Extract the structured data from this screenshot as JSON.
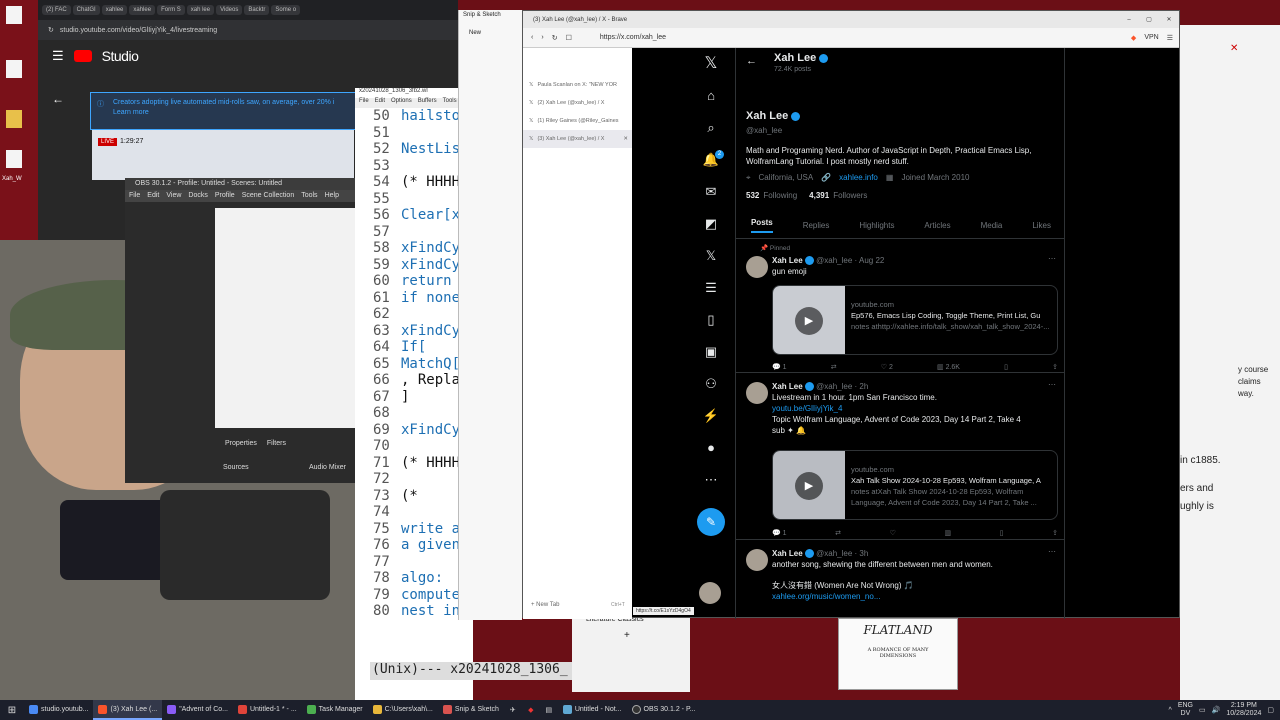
{
  "youtube": {
    "tabs": [
      "(2) FAC",
      "ChatGI",
      "xahlee",
      "xahlee",
      "Form S",
      "xah lee",
      "Videos",
      "Backtr",
      "Some o"
    ],
    "url": "studio.youtube.com/video/GlIiyjYik_4/livestreaming",
    "logo": "Studio",
    "banner_line1": "Creators adopting live automated mid-rolls saw, on average, over 20% i",
    "banner_line2": "Learn more",
    "live_badge": "LIVE",
    "live_time": "1:29:27"
  },
  "obs": {
    "title": "OBS 30.1.2 - Profile: Untitled - Scenes: Untitled",
    "menu": [
      "File",
      "Edit",
      "View",
      "Docks",
      "Profile",
      "Scene Collection",
      "Tools",
      "Help"
    ],
    "panels": [
      "Properties",
      "Filters"
    ],
    "sources": "Sources",
    "mixer": "Audio Mixer"
  },
  "emacs": {
    "title": "x20241028_1306_3fb2.wl",
    "menu": [
      "File",
      "Edit",
      "Options",
      "Buffers",
      "Tools"
    ],
    "lines": [
      {
        "n": "50",
        "t": "hailstor"
      },
      {
        "n": "51",
        "t": ""
      },
      {
        "n": "52",
        "t": "NestList"
      },
      {
        "n": "53",
        "t": ""
      },
      {
        "n": "54",
        "t": "(* HHHH-"
      },
      {
        "n": "55",
        "t": ""
      },
      {
        "n": "56",
        "t": "Clear[xF"
      },
      {
        "n": "57",
        "t": ""
      },
      {
        "n": "58",
        "t": "xFindCyc"
      },
      {
        "n": "59",
        "t": "xFindCyc"
      },
      {
        "n": "60",
        "t": "return a"
      },
      {
        "n": "61",
        "t": "if none,"
      },
      {
        "n": "62",
        "t": ""
      },
      {
        "n": "63",
        "t": "xFindCyc"
      },
      {
        "n": "64",
        "t": "If["
      },
      {
        "n": "65",
        "t": "MatchQ["
      },
      {
        "n": "66",
        "t": ", Replac"
      },
      {
        "n": "67",
        "t": "]"
      },
      {
        "n": "68",
        "t": ""
      },
      {
        "n": "69",
        "t": "xFindCyc"
      },
      {
        "n": "70",
        "t": ""
      },
      {
        "n": "71",
        "t": "(* HHHH-"
      },
      {
        "n": "72",
        "t": ""
      },
      {
        "n": "73",
        "t": "(*"
      },
      {
        "n": "74",
        "t": ""
      },
      {
        "n": "75",
        "t": "write a"
      },
      {
        "n": "76",
        "t": "a given"
      },
      {
        "n": "77",
        "t": ""
      },
      {
        "n": "78",
        "t": "algo:"
      },
      {
        "n": "79",
        "t": "compute the function s"
      },
      {
        "n": "80",
        "t": "nest in, for n times."
      }
    ],
    "modeline": "(Unix)--- x20241028_1306_"
  },
  "snip": {
    "title": "Snip & Sketch",
    "new": "New",
    "folder": "Literature Classics",
    "book_title": "FLATLAND",
    "book_sub": "A ROMANCE OF MANY DIMENSIONS"
  },
  "brave": {
    "title": "(3) Xah Lee (@xah_lee) / X - Brave",
    "url": "https://x.com/xah_lee",
    "vpn": "VPN",
    "tabs": [
      "Paula Scanlan on X: \"NEW YOR",
      "(2) Xah Lee (@xah_lee) / X",
      "(1) Riley Gaines (@Riley_Gaines",
      "(3) Xah Lee (@xah_lee) / X"
    ],
    "new_tab": "New Tab",
    "new_tab_shortcut": "Ctrl+T",
    "status_url": "https://t.co/E1sYzD4gO4"
  },
  "x": {
    "header_name": "Xah Lee",
    "header_posts": "72.4K posts",
    "name": "Xah Lee",
    "handle": "@xah_lee",
    "bio": "Math and Programing Nerd. Author of JavaScript in Depth, Practical Emacs Lisp, WolframLang Tutorial. I post mostly nerd stuff.",
    "location": "California, USA",
    "website": "xahlee.info",
    "joined": "Joined March 2010",
    "following_count": "532",
    "following_label": "Following",
    "followers_count": "4,391",
    "followers_label": "Followers",
    "tabs": [
      "Posts",
      "Replies",
      "Highlights",
      "Articles",
      "Media",
      "Likes"
    ],
    "notif_badge": "2",
    "tweets": [
      {
        "pinned": "Pinned",
        "name": "Xah Lee",
        "handle": "@xah_lee",
        "time": "· Aug 22",
        "text": "gun emoji",
        "card_domain": "youtube.com",
        "card_title": "Ep576, Emacs Lisp Coding, Toggle Theme, Print List, Gu",
        "card_desc": "notes athttp://xahlee.info/talk_show/xah_talk_show_2024-...",
        "replies": "1",
        "reposts": "",
        "likes": "2",
        "views": "2.6K"
      },
      {
        "name": "Xah Lee",
        "handle": "@xah_lee",
        "time": "· 2h",
        "text": "Livestream in 1 hour. 1pm San Francisco time.",
        "link": "youtu.be/GlIiyjYik_4",
        "text2": "Topic Wolfram Language, Advent of Code 2023, Day 14 Part 2, Take 4",
        "text3": "sub ✦ 🔔",
        "card_domain": "youtube.com",
        "card_title": "Xah Talk Show 2024-10-28 Ep593, Wolfram Language, A",
        "card_desc": "notes atXah Talk Show 2024-10-28 Ep593, Wolfram Language, Advent of Code 2023, Day 14 Part 2, Take ...",
        "replies": "1",
        "reposts": "",
        "likes": "",
        "views": ""
      },
      {
        "name": "Xah Lee",
        "handle": "@xah_lee",
        "time": "· 3h",
        "text": "another song, shewing the different between men and women.",
        "text2": "女人沒有錯 (Women Are Not Wrong) 🎵",
        "link": "xahlee.org/music/women_no..."
      }
    ]
  },
  "right_pane": {
    "text1": "in c1885.",
    "text2": "ers and",
    "text3": "ughly is",
    "text4": "y course",
    "text5": "claims",
    "text6": "way."
  },
  "taskbar": {
    "items": [
      "studio.youtub...",
      "(3) Xah Lee (...",
      "\"Advent of Co...",
      "Untitled-1 * - ...",
      "Task Manager",
      "C:\\Users\\xah\\...",
      "Snip & Sketch",
      "Untitled - Not...",
      "OBS 30.1.2 - P..."
    ],
    "lang": "ENG",
    "lang2": "DV",
    "time": "2:19 PM",
    "date": "10/28/2024"
  },
  "desktop": {
    "label": "Xah_W"
  }
}
